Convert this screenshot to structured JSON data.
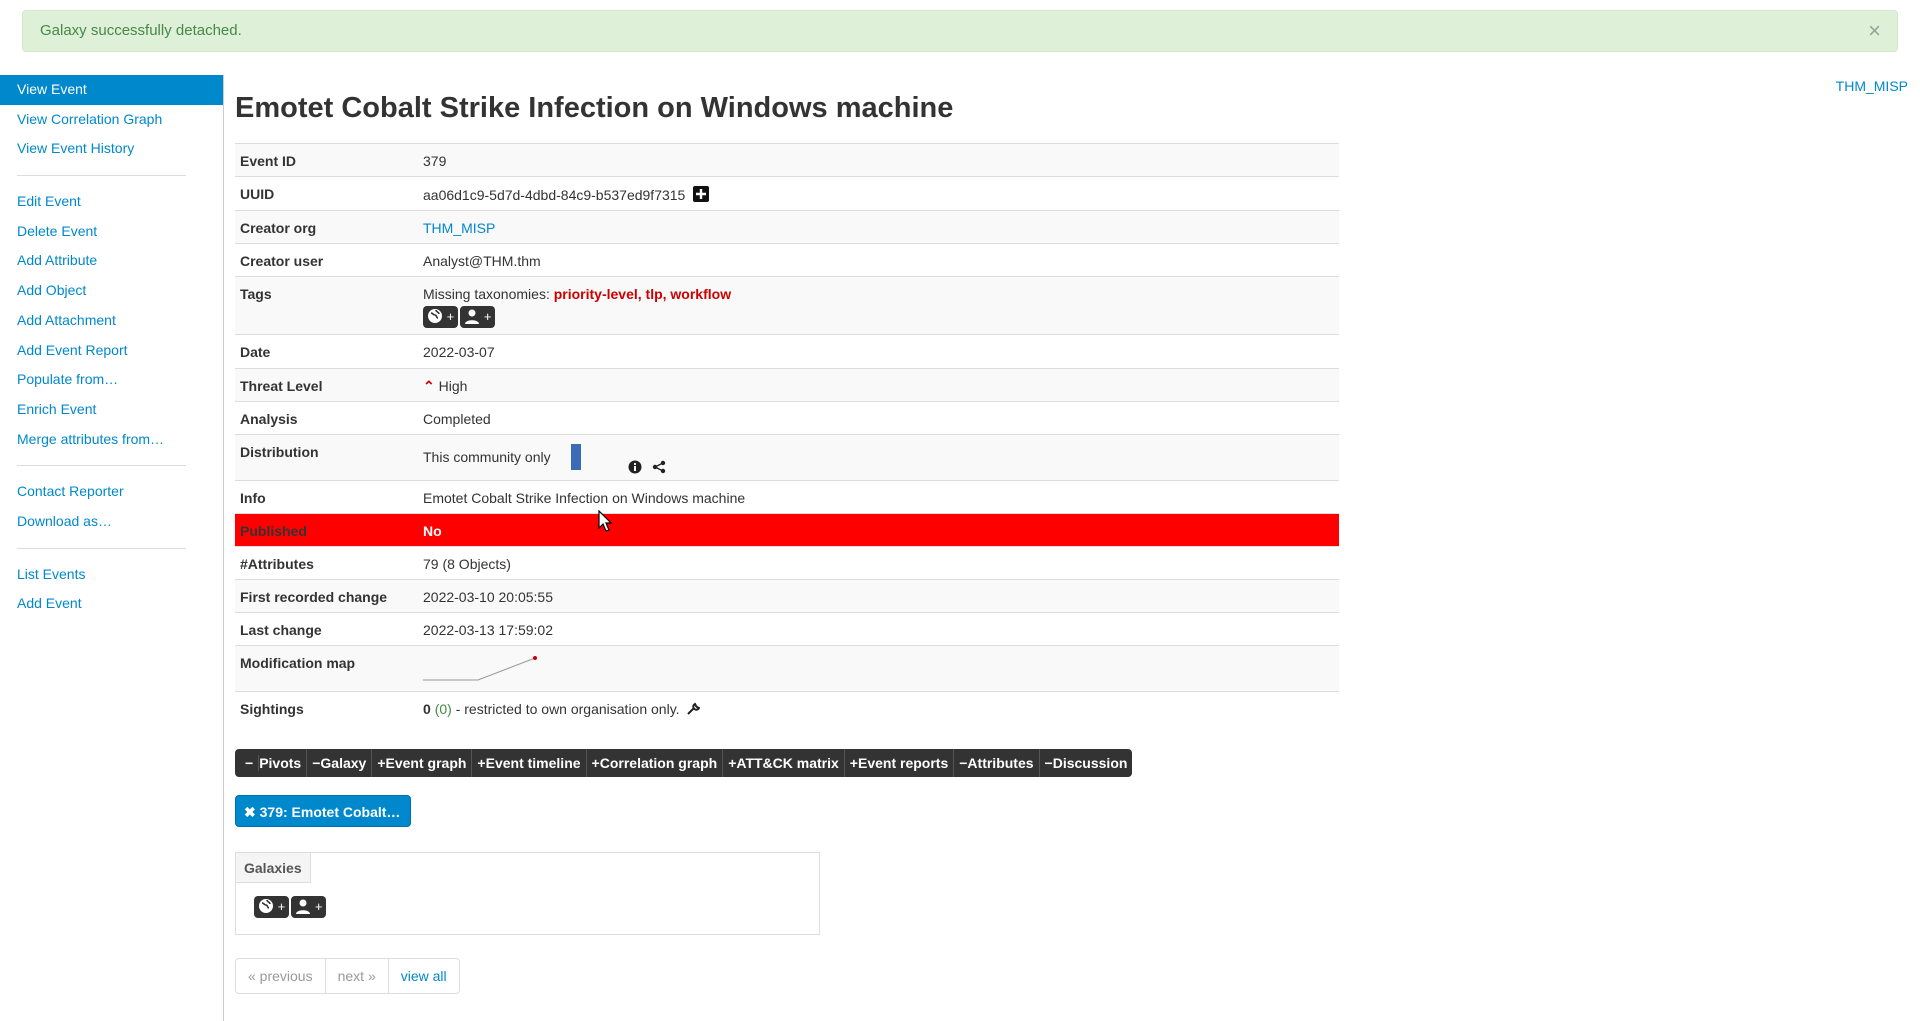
{
  "alert": {
    "message": "Galaxy successfully detached.",
    "close": "×"
  },
  "top_org": "THM_MISP",
  "sidebar": {
    "group1": [
      "View Event",
      "View Correlation Graph",
      "View Event History"
    ],
    "group2": [
      "Edit Event",
      "Delete Event",
      "Add Attribute",
      "Add Object",
      "Add Attachment",
      "Add Event Report",
      "Populate from…",
      "Enrich Event",
      "Merge attributes from…"
    ],
    "group3": [
      "Contact Reporter",
      "Download as…"
    ],
    "group4": [
      "List Events",
      "Add Event"
    ]
  },
  "title": "Emotet Cobalt Strike Infection on Windows machine",
  "meta": {
    "event_id": {
      "label": "Event ID",
      "value": "379"
    },
    "uuid": {
      "label": "UUID",
      "value": "aa06d1c9-5d7d-4dbd-84c9-b537ed9f7315"
    },
    "creator_org": {
      "label": "Creator org",
      "value": "THM_MISP"
    },
    "creator_user": {
      "label": "Creator user",
      "value": "Analyst@THM.thm"
    },
    "tags": {
      "label": "Tags",
      "prefix": "Missing taxonomies: ",
      "missing": "priority-level, tlp, workflow"
    },
    "date": {
      "label": "Date",
      "value": "2022-03-07"
    },
    "threat": {
      "label": "Threat Level",
      "value": "High"
    },
    "analysis": {
      "label": "Analysis",
      "value": "Completed"
    },
    "distribution": {
      "label": "Distribution",
      "value": "This community only"
    },
    "info": {
      "label": "Info",
      "value": "Emotet Cobalt Strike Infection on Windows machine"
    },
    "published": {
      "label": "Published",
      "value": "No"
    },
    "attributes": {
      "label": "#Attributes",
      "value": "79 (8 Objects)"
    },
    "first_change": {
      "label": "First recorded change",
      "value": "2022-03-10 20:05:55"
    },
    "last_change": {
      "label": "Last change",
      "value": "2022-03-13 17:59:02"
    },
    "modmap": {
      "label": "Modification map"
    },
    "sightings": {
      "label": "Sightings",
      "count": "0",
      "own": "(0)",
      "rest": " - restricted to own organisation only."
    }
  },
  "tabs": [
    {
      "sign": "−",
      "label": "Pivots"
    },
    {
      "sign": "−",
      "label": "Galaxy"
    },
    {
      "sign": "+",
      "label": "Event graph"
    },
    {
      "sign": "+",
      "label": "Event timeline"
    },
    {
      "sign": "+",
      "label": "Correlation graph"
    },
    {
      "sign": "+",
      "label": "ATT&CK matrix"
    },
    {
      "sign": "+",
      "label": "Event reports"
    },
    {
      "sign": "−",
      "label": "Attributes"
    },
    {
      "sign": "−",
      "label": "Discussion"
    }
  ],
  "pivot_pill": "379: Emotet Cobalt…",
  "galaxies": {
    "header": "Galaxies"
  },
  "pager": {
    "previous": "« previous",
    "next": "next »",
    "view_all": "view all"
  },
  "colors": {
    "accent": "#0088cc",
    "published_bg": "#ff0000",
    "alert_bg": "#dff0d8"
  }
}
